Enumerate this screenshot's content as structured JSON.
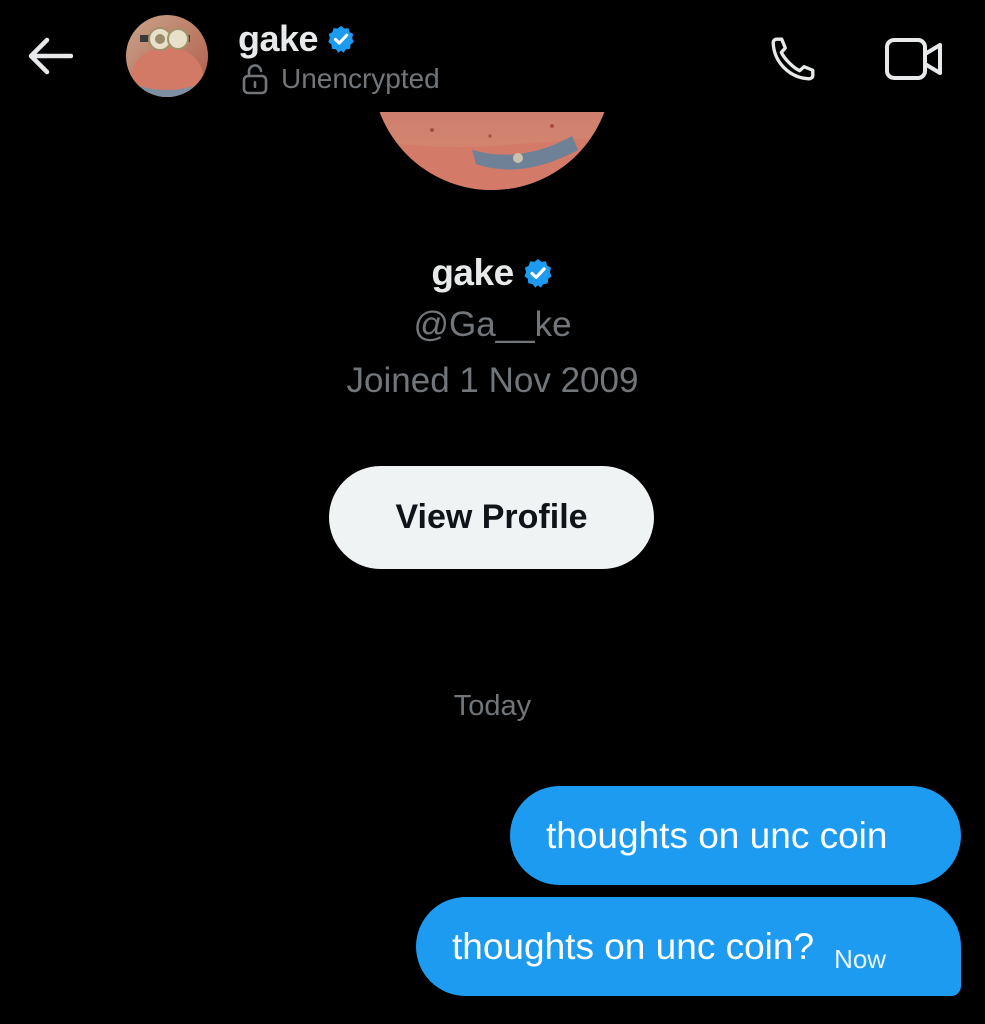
{
  "header": {
    "name": "gake",
    "status": "Unencrypted"
  },
  "profile": {
    "name": "gake",
    "handle": "@Ga__ke",
    "joined": "Joined 1 Nov 2009",
    "view_profile_label": "View Profile"
  },
  "conversation": {
    "date_divider": "Today",
    "messages": [
      {
        "text": "thoughts on unc coin",
        "time": ""
      },
      {
        "text": "thoughts on unc coin?",
        "time": "Now"
      }
    ]
  },
  "icons": {
    "back": "arrow-left-icon",
    "verified": "verified-badge-icon",
    "lock": "unlocked-icon",
    "call": "phone-icon",
    "video": "video-camera-icon"
  },
  "colors": {
    "background": "#000000",
    "accent": "#1d9bf0",
    "text_primary": "#e7e9ea",
    "text_secondary": "#71767b",
    "button_bg": "#eff3f4"
  }
}
